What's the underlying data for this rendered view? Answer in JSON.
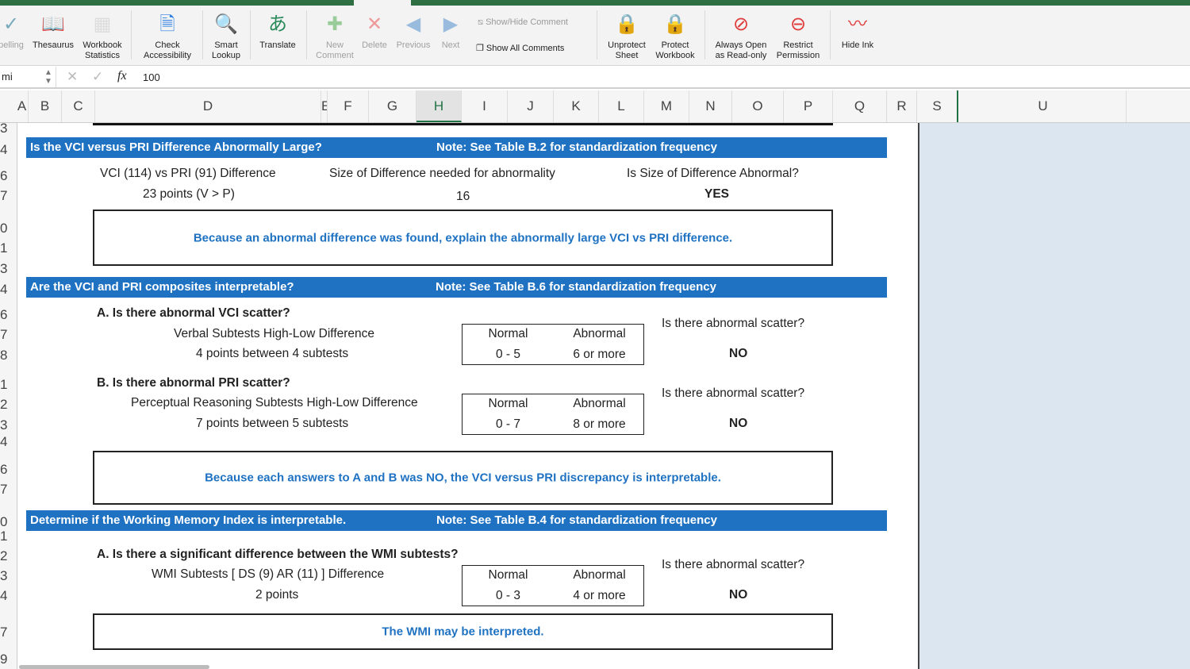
{
  "ribbon": {
    "spelling": "pelling",
    "thesaurus": "Thesaurus",
    "workbook_stats": "Workbook Statistics",
    "check_access": "Check Accessibility",
    "smart_lookup": "Smart Lookup",
    "translate": "Translate",
    "new_comment": "New Comment",
    "delete": "Delete",
    "previous": "Previous",
    "next": "Next",
    "show_hide_comment": "Show/Hide Comment",
    "show_all_comments": "Show All Comments",
    "unprotect_sheet": "Unprotect Sheet",
    "protect_workbook": "Protect Workbook",
    "always_open": "Always Open as Read-only",
    "restrict": "Restrict Permission",
    "hide_ink": "Hide Ink"
  },
  "formula_bar": {
    "name_box": "mi",
    "fx": "fx",
    "value": "100"
  },
  "columns": [
    "A",
    "B",
    "C",
    "D",
    "E",
    "F",
    "G",
    "H",
    "I",
    "J",
    "K",
    "L",
    "M",
    "N",
    "O",
    "P",
    "Q",
    "R",
    "S",
    "U"
  ],
  "rows": [
    "3",
    "4",
    "6",
    "7",
    "0",
    "1",
    "3",
    "4",
    "6",
    "7",
    "8",
    "1",
    "2",
    "3",
    "4",
    "6",
    "7",
    "0",
    "1",
    "2",
    "3",
    "4",
    "7",
    "9"
  ],
  "s1": {
    "title": "Is the VCI versus PRI Difference Abnormally Large?",
    "note": "Note: See Table B.2 for standardization frequency",
    "h1": "VCI (114) vs PRI (91) Difference",
    "h2": "Size of Difference needed for abnormality",
    "h3": "Is Size of Difference Abnormal?",
    "v1": "23 points (V > P)",
    "v2": "16",
    "v3": "YES",
    "msg": "Because an abnormal difference was found, explain the abnormally large VCI vs PRI difference."
  },
  "s2": {
    "title": "Are the VCI and PRI composites interpretable?",
    "note": "Note: See Table B.6 for standardization frequency",
    "a_q": "A. Is there abnormal VCI scatter?",
    "a_l1": "Verbal Subtests High-Low Difference",
    "a_l2": "4 points between 4 subtests",
    "a_normal": "Normal",
    "a_abnormal": "Abnormal",
    "a_nr": "0 - 5",
    "a_ar": "6 or more",
    "a_scatter_q": "Is there abnormal scatter?",
    "a_ans": "NO",
    "b_q": "B. Is there abnormal PRI scatter?",
    "b_l1": "Perceptual Reasoning Subtests High-Low Difference",
    "b_l2": "7 points between 5 subtests",
    "b_normal": "Normal",
    "b_abnormal": "Abnormal",
    "b_nr": "0 - 7",
    "b_ar": "8 or more",
    "b_scatter_q": "Is there abnormal scatter?",
    "b_ans": "NO",
    "msg": "Because each answers to A and B was NO, the VCI versus PRI discrepancy is interpretable."
  },
  "s3": {
    "title": "Determine if the Working Memory Index is interpretable.",
    "note": "Note: See Table B.4 for standardization frequency",
    "a_q": "A. Is there a significant difference between the WMI subtests?",
    "l1": "WMI Subtests [ DS (9) AR (11) ] Difference",
    "l2": "2 points",
    "normal": "Normal",
    "abnormal": "Abnormal",
    "nr": "0 - 3",
    "ar": "4 or more",
    "scatter_q": "Is there abnormal scatter?",
    "ans": "NO",
    "msg": "The WMI may be interpreted."
  }
}
